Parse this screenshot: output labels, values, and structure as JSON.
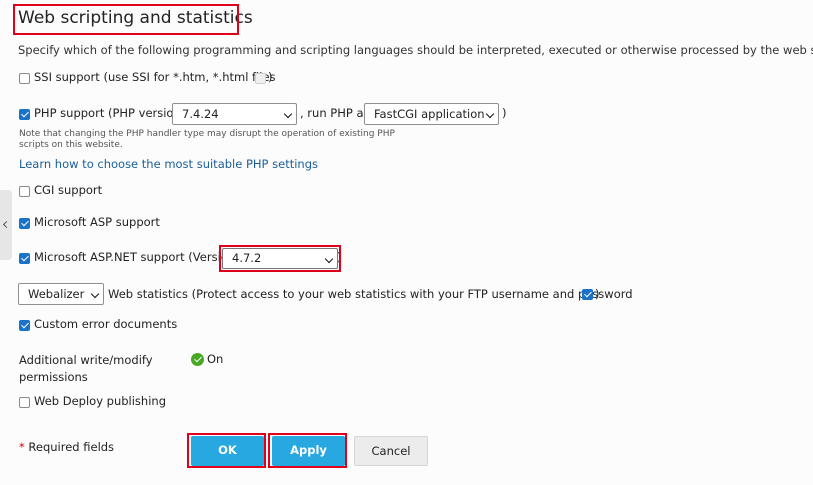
{
  "section": {
    "title": "Web scripting and statistics",
    "description": "Specify which of the following programming and scripting languages should be interpreted, executed or otherwise processed by the web server."
  },
  "ssi": {
    "label": "SSI support (use SSI for *.htm, *.html files",
    "suffix": ")",
    "checked": false
  },
  "php": {
    "label": "PHP support (PHP version",
    "version": "7.4.24",
    "run_as_label": ", run PHP as",
    "handler": "FastCGI application",
    "suffix": ")",
    "checked": true,
    "note_line1": "Note that changing the PHP handler type may disrupt the operation of existing PHP",
    "note_line2": "scripts on this website.",
    "link": "Learn how to choose the most suitable PHP settings"
  },
  "cgi": {
    "label": "CGI support",
    "checked": false
  },
  "asp": {
    "label": "Microsoft ASP support",
    "checked": true
  },
  "aspnet": {
    "label": "Microsoft ASP.NET support (Version",
    "version": "4.7.2",
    "suffix": ")",
    "checked": true
  },
  "stats": {
    "tool": "Webalizer",
    "label": "Web statistics (Protect access to your web statistics with your FTP username and password",
    "suffix": ")",
    "checked": true
  },
  "custom_errors": {
    "label": "Custom error documents",
    "checked": true
  },
  "permissions": {
    "label_line1": "Additional write/modify",
    "label_line2": "permissions",
    "status": "On",
    "status_color": "#47a823"
  },
  "web_deploy": {
    "label": "Web Deploy publishing",
    "checked": false
  },
  "footer": {
    "required_star": "*",
    "required_label": "Required fields",
    "ok": "OK",
    "apply": "Apply",
    "cancel": "Cancel"
  },
  "colors": {
    "primary": "#28a8e0",
    "checkbox": "#1a73c9",
    "highlight": "#e0001b",
    "link": "#1a5f99"
  }
}
